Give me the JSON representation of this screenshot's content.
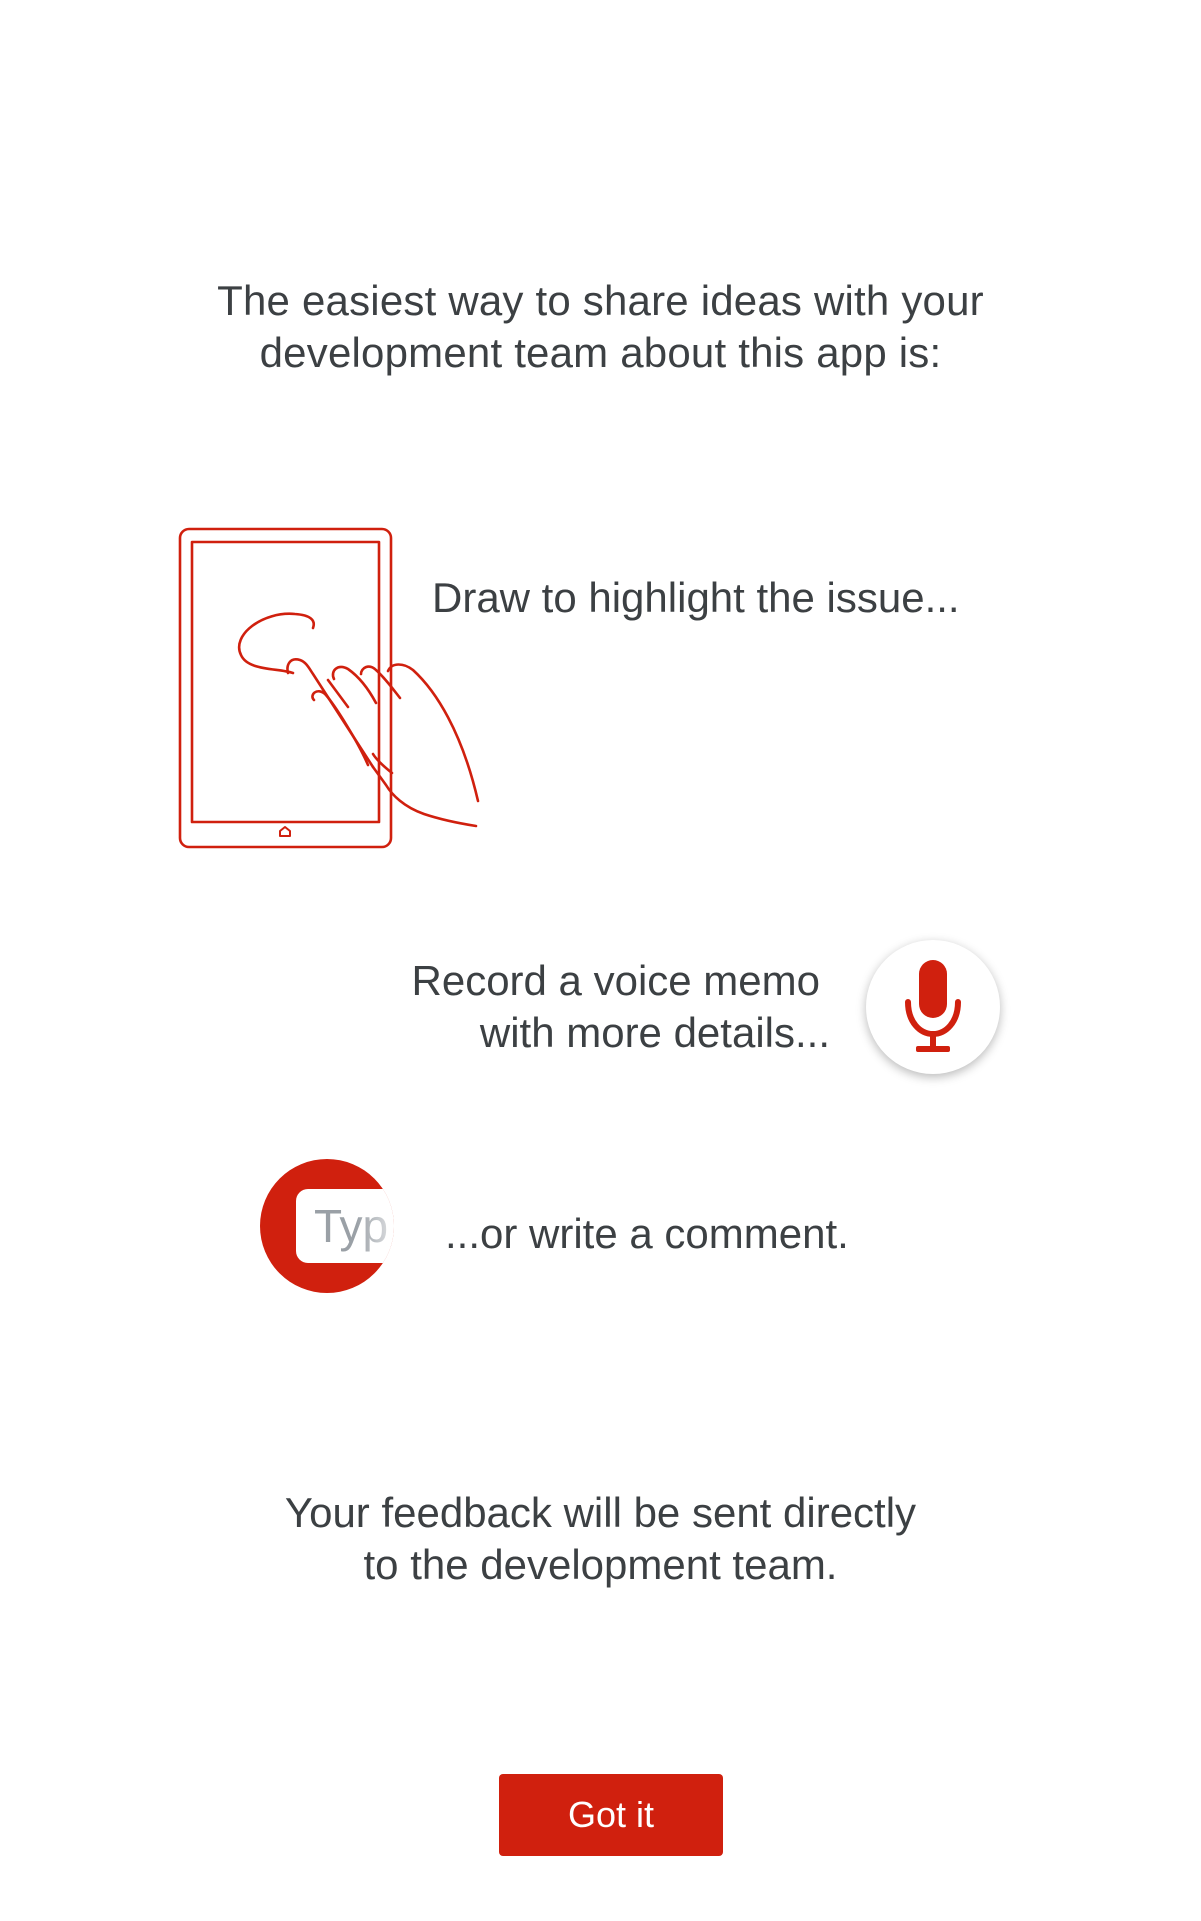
{
  "intro": {
    "line1": "The easiest way to share ideas with your",
    "line2": "development team about this app is:"
  },
  "steps": {
    "draw": {
      "text": "Draw to highlight the issue...",
      "icon": "tablet-with-hand-drawing-icon"
    },
    "voice": {
      "line1": "Record a voice memo",
      "line2": "with more details...",
      "icon": "microphone-icon"
    },
    "comment": {
      "field_text": "Typ",
      "text": "...or write a comment.",
      "icon": "comment-field-icon"
    }
  },
  "footer_note": {
    "line1": "Your feedback will be sent directly",
    "line2": "to the development team."
  },
  "button": {
    "label": "Got it"
  },
  "colors": {
    "accent": "#d0200e",
    "text": "#3c4043",
    "background": "#ffffff"
  }
}
